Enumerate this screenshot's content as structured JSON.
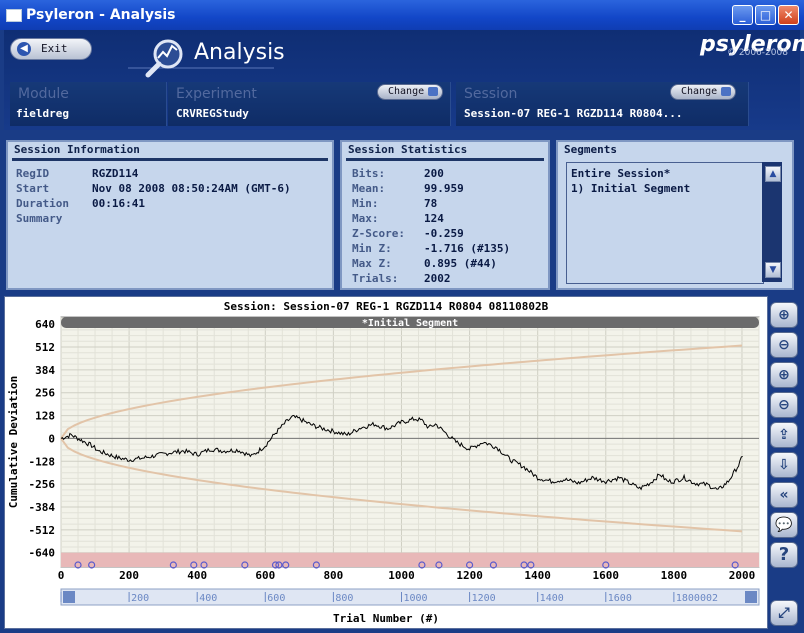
{
  "window": {
    "title": "Psyleron - Analysis",
    "min": "_",
    "max": "□",
    "close": "✕"
  },
  "header": {
    "exit_label": "Exit",
    "section_title": "Analysis",
    "brand": "psyleron",
    "copyright": "© 2006-2008",
    "module": {
      "label": "Module",
      "value": "fieldreg"
    },
    "experiment": {
      "label": "Experiment",
      "value": "CRVREGStudy",
      "change_label": "Change"
    },
    "session": {
      "label": "Session",
      "value": "Session-07 REG-1 RGZD114 R0804...",
      "change_label": "Change"
    }
  },
  "session_info": {
    "title": "Session Information",
    "rows": [
      {
        "key": "RegID",
        "value": "RGZD114"
      },
      {
        "key": "Start",
        "value": "Nov 08 2008 08:50:24AM (GMT-6)"
      },
      {
        "key": "Duration",
        "value": "00:16:41"
      },
      {
        "key": "Summary",
        "value": ""
      }
    ]
  },
  "session_stats": {
    "title": "Session Statistics",
    "rows": [
      {
        "key": "Bits:",
        "value": "200"
      },
      {
        "key": "Mean:",
        "value": "99.959"
      },
      {
        "key": "Min:",
        "value": "78"
      },
      {
        "key": "Max:",
        "value": "124"
      },
      {
        "key": "Z-Score:",
        "value": "-0.259"
      },
      {
        "key": "Min Z:",
        "value": "-1.716 (#135)"
      },
      {
        "key": "Max Z:",
        "value": "0.895 (#44)"
      },
      {
        "key": "Trials:",
        "value": "2002"
      }
    ]
  },
  "segments": {
    "title": "Segments",
    "items": [
      "Entire Session*",
      "1) Initial Segment"
    ],
    "scroll_up": "▲",
    "scroll_down": "▼"
  },
  "toolbar_icons": [
    "zoom-in-x-icon",
    "zoom-out-x-icon",
    "zoom-in-y-icon",
    "zoom-out-y-icon",
    "export-icon",
    "download-icon",
    "back-icon",
    "comment-icon",
    "help-icon"
  ],
  "chart_data": {
    "type": "line",
    "title": "Session: Session-07 REG-1 RGZD114 R0804 08110802B",
    "segment_label": "*Initial Segment",
    "xlabel": "Trial Number (#)",
    "ylabel": "Cumulative Deviation",
    "xlim": [
      0,
      2050
    ],
    "ylim": [
      -720,
      680
    ],
    "yticks": [
      640,
      512,
      384,
      256,
      128,
      0,
      -128,
      -256,
      -384,
      -512,
      -640
    ],
    "ytick_labels": [
      "640",
      "512",
      "384",
      "256",
      "128",
      "0",
      "-128",
      "-256",
      "-384",
      "-512",
      "-640"
    ],
    "xticks": [
      0,
      200,
      400,
      600,
      800,
      1000,
      1200,
      1400,
      1600,
      1800,
      2000
    ],
    "xtick_labels": [
      "0",
      "200",
      "400",
      "600",
      "800",
      "1000",
      "1200",
      "1400",
      "1600",
      "1800",
      "2000"
    ],
    "scrollbar_labels": [
      "0",
      "200",
      "400",
      "600",
      "800",
      "1000",
      "1200",
      "1400",
      "1600",
      "1800002"
    ],
    "grid": true,
    "envelope_z": 1.645,
    "colors": {
      "deviation": "#000000",
      "envelope": "#e2c4a8",
      "band": "#e8b8b8",
      "marker": "#5a5acc",
      "header_bar": "#6b6b6b",
      "plot_bg": "#f3f3ea"
    },
    "series": [
      {
        "x": [
          0,
          30,
          60,
          90,
          110,
          140,
          170,
          200,
          240,
          280,
          320,
          360,
          400,
          440,
          480,
          520,
          560,
          600,
          630,
          660,
          680,
          700,
          730,
          760,
          800,
          840,
          880,
          920,
          960,
          1000,
          1040,
          1060,
          1080,
          1100,
          1130,
          1160,
          1200,
          1240,
          1280,
          1320,
          1360,
          1400,
          1440,
          1480,
          1520,
          1560,
          1600,
          1640,
          1680,
          1700,
          1730,
          1760,
          1780,
          1800,
          1830,
          1860,
          1900,
          1930,
          1960,
          1990,
          2002
        ],
        "y": [
          0,
          20,
          -10,
          -40,
          -70,
          -90,
          -110,
          -120,
          -110,
          -95,
          -80,
          -70,
          -90,
          -60,
          -70,
          -65,
          -100,
          -40,
          30,
          90,
          120,
          110,
          80,
          60,
          40,
          20,
          60,
          80,
          55,
          90,
          110,
          100,
          60,
          80,
          30,
          -20,
          -60,
          -20,
          -50,
          -120,
          -160,
          -220,
          -240,
          -230,
          -250,
          -220,
          -240,
          -220,
          -260,
          -280,
          -250,
          -200,
          -240,
          -240,
          -220,
          -250,
          -260,
          -290,
          -240,
          -150,
          -100
        ]
      }
    ],
    "markers_x": [
      50,
      90,
      330,
      390,
      420,
      540,
      630,
      640,
      660,
      750,
      1060,
      1110,
      1200,
      1270,
      1360,
      1380,
      1600,
      1980
    ]
  }
}
